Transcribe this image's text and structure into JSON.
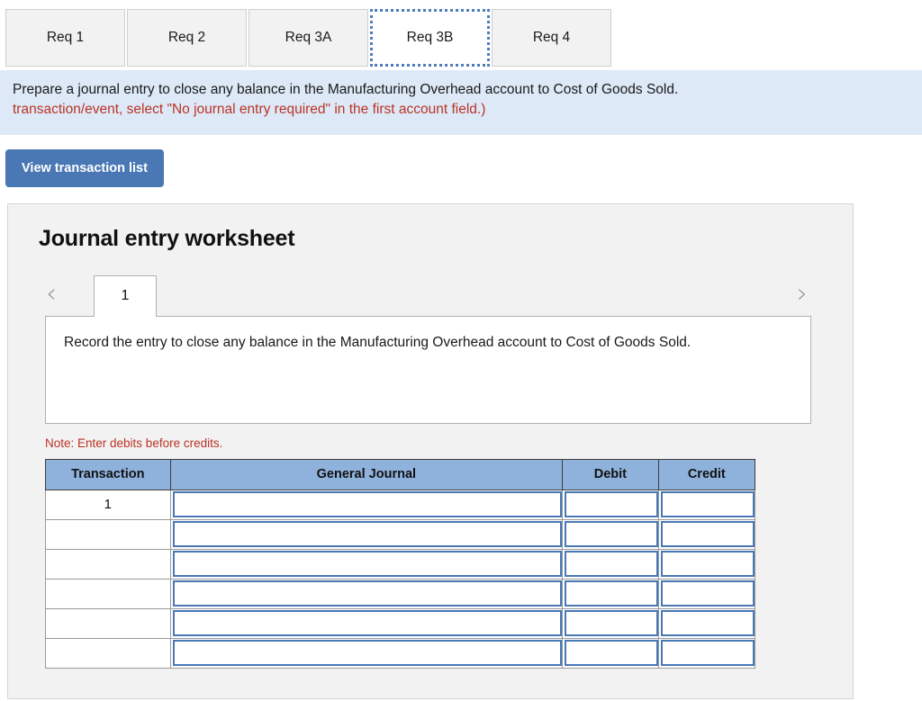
{
  "req_tabs": [
    {
      "label": "Req 1",
      "active": false
    },
    {
      "label": "Req 2",
      "active": false
    },
    {
      "label": "Req 3A",
      "active": false
    },
    {
      "label": "Req 3B",
      "active": true
    },
    {
      "label": "Req 4",
      "active": false
    }
  ],
  "banner": {
    "line1": "Prepare a journal entry to close any balance in the Manufacturing Overhead account to Cost of Goods Sold.",
    "line2": "transaction/event, select \"No journal entry required\" in the first account field.)",
    "line1_color": "#1a1a1a",
    "line2_color": "#bb3325",
    "background": "#dde9f7"
  },
  "toolbar": {
    "view_transaction_list_label": "View transaction list",
    "button_color": "#4a78b5"
  },
  "worksheet": {
    "title": "Journal entry worksheet",
    "prev_icon": "‹",
    "next_icon": "›",
    "sheet_tabs": [
      "1"
    ],
    "description": "Record the entry to close any balance in the Manufacturing Overhead account to Cost of Goods Sold.",
    "note": "Note: Enter debits before credits.",
    "note_color": "#bb3325"
  },
  "table": {
    "header_color": "#8fb2dd",
    "headers": [
      "Transaction",
      "General Journal",
      "Debit",
      "Credit"
    ],
    "rows": [
      {
        "transaction": "1",
        "general_journal": "",
        "debit": "",
        "credit": ""
      },
      {
        "transaction": "",
        "general_journal": "",
        "debit": "",
        "credit": ""
      },
      {
        "transaction": "",
        "general_journal": "",
        "debit": "",
        "credit": ""
      },
      {
        "transaction": "",
        "general_journal": "",
        "debit": "",
        "credit": ""
      },
      {
        "transaction": "",
        "general_journal": "",
        "debit": "",
        "credit": ""
      },
      {
        "transaction": "",
        "general_journal": "",
        "debit": "",
        "credit": ""
      }
    ]
  }
}
